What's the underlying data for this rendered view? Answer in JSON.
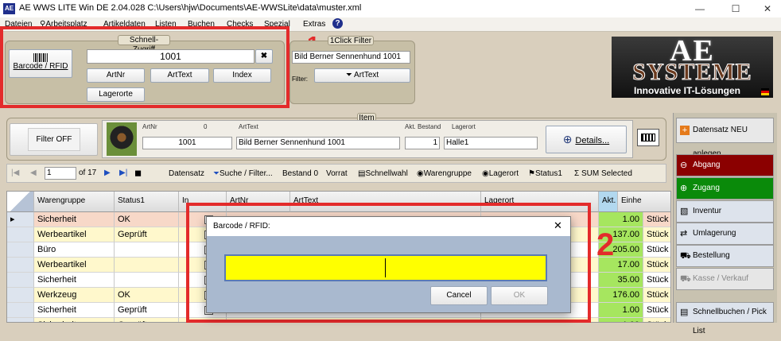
{
  "window": {
    "title": "AE WWS LITE Win DE 2.04.028 C:\\Users\\hjw\\Documents\\AE-WWSLite\\data\\muster.xml",
    "logo_text": "AE",
    "minimize": "—",
    "maximize": "☐",
    "close": "✕"
  },
  "menu": [
    "Dateien",
    "Arbeitsplatz",
    "Artikeldaten",
    "Listen",
    "Buchen",
    "Checks",
    "Spezial",
    "Extras",
    "?"
  ],
  "schnell_zugriff": {
    "title": "Schnell-Zugriff",
    "barcode_button": "Barcode / RFID",
    "search_value": "1001",
    "clear_symbol": "✖",
    "buttons": {
      "artnr": "ArtNr",
      "arttext": "ArtText",
      "index": "Index",
      "lagerorte": "Lagerorte"
    }
  },
  "one_click_filter": {
    "title": "1Click Filter",
    "field_value": "Bild Berner Sennenhund 1001",
    "filter_label": "Filter:",
    "arttext_button": "ArtText"
  },
  "logo": {
    "line1": "AE",
    "line2": "SYSTEME",
    "line3": "Innovative IT-Lösungen"
  },
  "item_panel": {
    "title": "Item",
    "filter_button": "Filter OFF",
    "labels": {
      "artnr": "ArtNr",
      "zero": "0",
      "arttext": "ArtText",
      "bestand": "Akt. Bestand",
      "lagerort": "Lagerort"
    },
    "values": {
      "artnr": "1001",
      "arttext": "Bild Berner Sennenhund 1001",
      "bestand": "1",
      "lagerort": "Halle1"
    },
    "details_button": "Details..."
  },
  "sidebar": [
    {
      "label": "Datensatz NEU anlegen",
      "icon": "+",
      "bg": "#e8e8e8"
    },
    {
      "label": "Abgang",
      "icon": "−",
      "bg": "#8b0000"
    },
    {
      "label": "Zugang",
      "icon": "+",
      "bg": "#0a8a0a"
    },
    {
      "label": "Inventur",
      "icon": "▦",
      "bg": "#dde3ec"
    },
    {
      "label": "Umlagerung",
      "icon": "⇄",
      "bg": "#dde3ec"
    },
    {
      "label": "Bestellung",
      "icon": "🛒",
      "bg": "#dde3ec"
    },
    {
      "label": "Kasse / Verkauf",
      "icon": "🛒",
      "bg": "#e6e6e6"
    },
    {
      "label": "Schnellbuchen / Pick List",
      "icon": "▤",
      "bg": "#dde3ec"
    }
  ],
  "toolbar": {
    "page_value": "1",
    "page_of": "of 17",
    "items": [
      "Datensatz",
      "Suche / Filter...",
      "Bestand 0",
      "Vorrat",
      "Schnellwahl",
      "Warengruppe",
      "Lagerort",
      "Status1",
      "SUM Selected"
    ]
  },
  "table": {
    "headers": [
      "Warengruppe",
      "Status1",
      "In Bestellung",
      "ArtNr",
      "ArtText",
      "Lagerort",
      "Akt. Bestand",
      "Einhe"
    ],
    "rows": [
      {
        "warengruppe": "Sicherheit",
        "status": "OK",
        "bestand": "1.00",
        "einheit": "Stück",
        "color": "#f7d8c8"
      },
      {
        "warengruppe": "Werbeartikel",
        "status": "Geprüft",
        "bestand": "137.00",
        "einheit": "Stück",
        "color": "#fff8cc"
      },
      {
        "warengruppe": "Büro",
        "status": "",
        "bestand": "205.00",
        "einheit": "Stück",
        "color": "#ffffff"
      },
      {
        "warengruppe": "Werbeartikel",
        "status": "",
        "bestand": "17.00",
        "einheit": "Stück",
        "color": "#fff8cc"
      },
      {
        "warengruppe": "Sicherheit",
        "status": "",
        "bestand": "35.00",
        "einheit": "Stück",
        "color": "#ffffff"
      },
      {
        "warengruppe": "Werkzeug",
        "status": "OK",
        "bestand": "176.00",
        "einheit": "Stück",
        "color": "#fff8cc"
      },
      {
        "warengruppe": "Sicherheit",
        "status": "Geprüft",
        "bestand": "1.00",
        "einheit": "Stück",
        "color": "#ffffff"
      },
      {
        "warengruppe": "Sicherheit",
        "status": "Geprüft",
        "bestand": "1.00",
        "einheit": "Stück",
        "color": "#fff8cc"
      }
    ]
  },
  "dialog": {
    "title": "Barcode / RFID:",
    "close": "✕",
    "cancel": "Cancel",
    "ok": "OK",
    "input_color": "#ffff00"
  },
  "annotations": {
    "one": "1",
    "two": "2",
    "color": "#e32b2b"
  }
}
